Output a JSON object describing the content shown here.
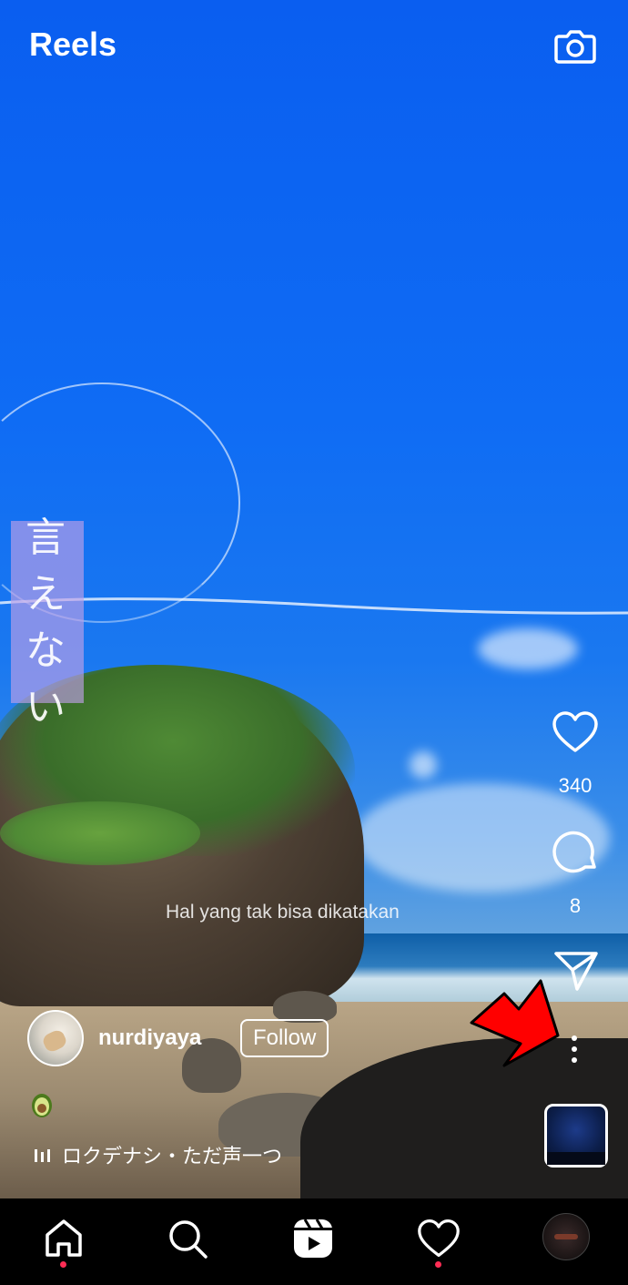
{
  "header": {
    "title": "Reels",
    "camera_icon": "camera-icon"
  },
  "overlay": {
    "vertical_text": [
      "言",
      "え",
      "な",
      "い"
    ],
    "subtitle": "Hal yang tak bisa dikatakan"
  },
  "actions": {
    "like": {
      "icon": "heart-icon",
      "count": "340"
    },
    "comment": {
      "icon": "comment-icon",
      "count": "8"
    },
    "share": {
      "icon": "paper-plane-icon"
    },
    "more": {
      "icon": "more-vertical-icon"
    }
  },
  "post": {
    "username": "nurdiyaya",
    "follow_label": "Follow",
    "emoji": "🥑",
    "music_title": "ロクデナシ・ただ声一つ"
  },
  "nav": {
    "items": [
      "home-icon",
      "search-icon",
      "reels-icon",
      "heart-icon",
      "profile-avatar"
    ],
    "badge_color": "#ff2d55"
  },
  "annotation": {
    "arrow_color": "#ff0000"
  }
}
